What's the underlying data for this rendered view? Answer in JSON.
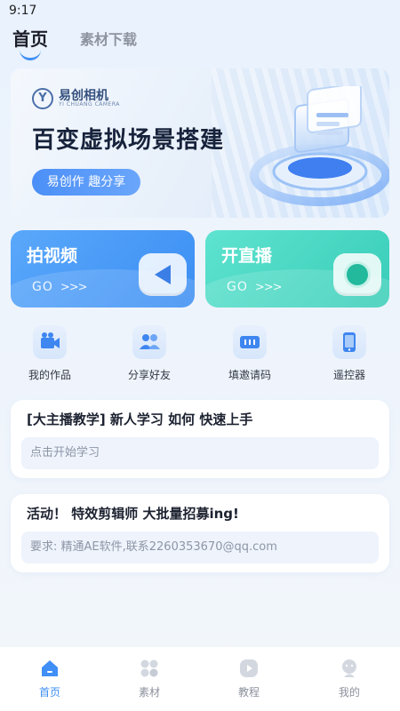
{
  "status_bar": {
    "time": "9:17"
  },
  "top_tabs": {
    "home": "首页",
    "materials": "素材下载"
  },
  "banner": {
    "logo_text": "易创相机",
    "logo_sub": "YI CHUANG CAMERA",
    "title": "百变虚拟场景搭建",
    "pill": "易创作 趣分享"
  },
  "actions": [
    {
      "title": "拍视频",
      "go": "GO",
      "arrows": ">>>",
      "icon": "play-icon"
    },
    {
      "title": "开直播",
      "go": "GO",
      "arrows": ">>>",
      "icon": "live-dot-icon"
    }
  ],
  "shortcuts": [
    {
      "label": "我的作品",
      "icon": "video-camera-icon"
    },
    {
      "label": "分享好友",
      "icon": "users-icon"
    },
    {
      "label": "填邀请码",
      "icon": "code-icon"
    },
    {
      "label": "遥控器",
      "icon": "phone-icon"
    }
  ],
  "cards": [
    {
      "title": "[大主播教学] 新人学习 如何 快速上手",
      "field": "点击开始学习"
    },
    {
      "title": "活动！ 特效剪辑师 大批量招募ing!",
      "field": "要求: 精通AE软件,联系2260353670@qq.com"
    }
  ],
  "bottom_nav": [
    {
      "label": "首页",
      "icon": "home-icon",
      "active": true
    },
    {
      "label": "素材",
      "icon": "grid-icon",
      "active": false
    },
    {
      "label": "教程",
      "icon": "play-circle-icon",
      "active": false
    },
    {
      "label": "我的",
      "icon": "user-face-icon",
      "active": false
    }
  ],
  "colors": {
    "accent": "#3f8ff6",
    "video_card": "#3b8ef3",
    "live_card": "#38cdb8"
  }
}
